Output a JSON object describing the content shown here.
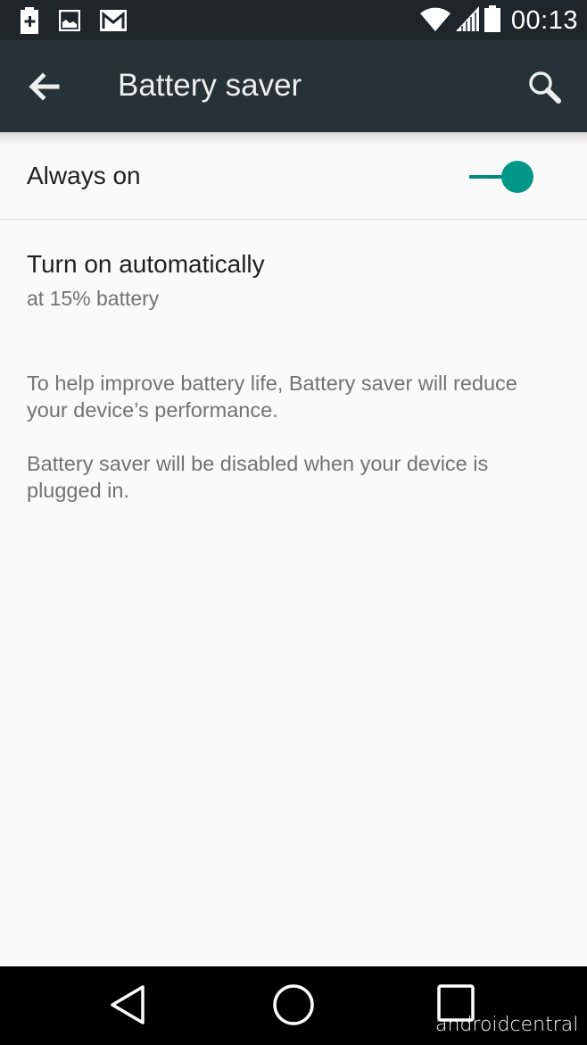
{
  "status_bar": {
    "left_icons": [
      "battery-saver-notification-icon",
      "image-icon",
      "gmail-icon"
    ],
    "right_icons": [
      "wifi-icon",
      "cell-signal-icon",
      "battery-icon"
    ],
    "time": "00:13"
  },
  "app_bar": {
    "title": "Battery saver",
    "back_icon": "arrow-back-icon",
    "search_icon": "search-icon"
  },
  "settings": {
    "always_on": {
      "label": "Always on",
      "toggle_on": true,
      "accent": "#009688"
    },
    "auto": {
      "label": "Turn on automatically",
      "summary": "at 15% battery"
    }
  },
  "info": {
    "paragraph1": "To help improve battery life, Battery saver will reduce your device’s performance.",
    "paragraph2": "Battery saver will be disabled when your device is plugged in."
  },
  "nav_bar": {
    "buttons": [
      "back-icon",
      "home-icon",
      "recents-icon"
    ]
  },
  "watermark": "androidcentral"
}
